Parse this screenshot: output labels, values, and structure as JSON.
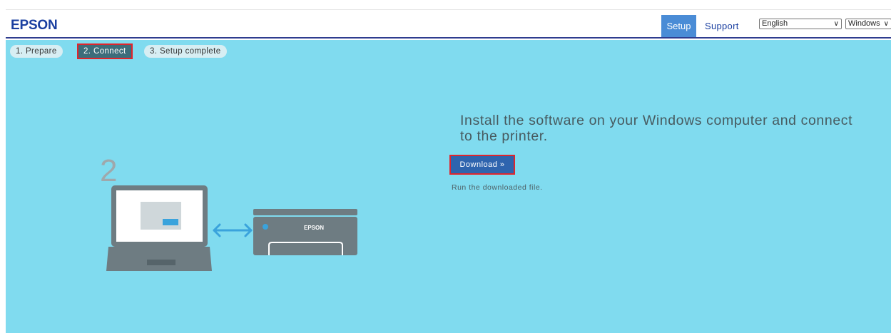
{
  "header": {
    "logo": "EPSON",
    "nav": {
      "setup": "Setup",
      "support": "Support"
    },
    "language_select": {
      "value": "English"
    },
    "os_select": {
      "value": "Windows"
    }
  },
  "steps": [
    {
      "label": "1. Prepare"
    },
    {
      "label": "2. Connect"
    },
    {
      "label": "3. Setup complete"
    }
  ],
  "illustration": {
    "step_number": "2",
    "printer_brand": "EPSON"
  },
  "main": {
    "headline": "Install the software on your Windows computer and connect to the printer.",
    "download_button": "Download »",
    "instruction": "Run the downloaded file."
  },
  "colors": {
    "content_background": "#80dbef",
    "nav_active": "#4a8cd6",
    "download_button": "#2e64ae",
    "highlight_border": "#e0252c",
    "device_gray": "#6e7c82"
  }
}
